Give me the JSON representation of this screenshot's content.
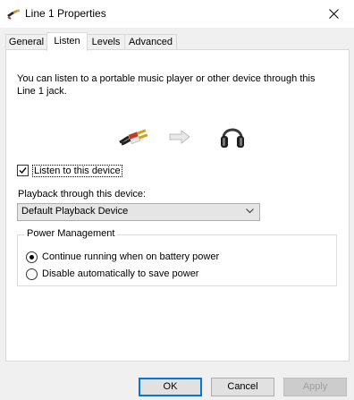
{
  "window": {
    "title": "Line 1 Properties"
  },
  "tabs": [
    {
      "label": "General"
    },
    {
      "label": "Listen"
    },
    {
      "label": "Levels"
    },
    {
      "label": "Advanced"
    }
  ],
  "listen": {
    "description": "You can listen to a portable music player or other device through this Line 1 jack.",
    "checkbox_label": "Listen to this device",
    "checkbox_checked": true,
    "playback_label": "Playback through this device:",
    "playback_selected": "Default Playback Device",
    "power": {
      "title": "Power Management",
      "option_continue": "Continue running when on battery power",
      "option_disable": "Disable automatically to save power",
      "selected": "continue"
    }
  },
  "buttons": {
    "ok": "OK",
    "cancel": "Cancel",
    "apply": "Apply"
  },
  "icons": {
    "title": "audio-jack-icon",
    "close": "close-icon",
    "jack": "audio-jack-icon",
    "arrow": "arrow-right-icon",
    "headphones": "headphones-icon",
    "dropdown": "chevron-down-icon"
  },
  "colors": {
    "accent": "#0078d7"
  }
}
